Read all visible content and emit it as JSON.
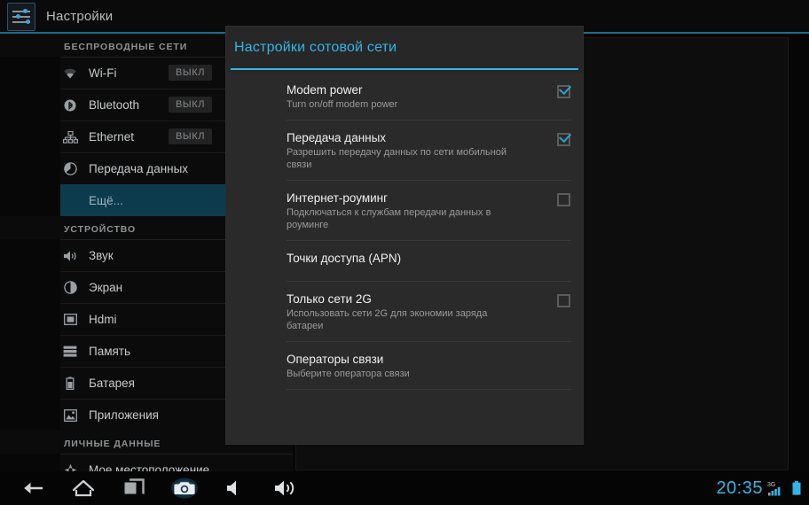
{
  "window": {
    "app_title": "Настройки",
    "app_icon": "sliders-icon"
  },
  "settings_list": {
    "sections": [
      {
        "header": "БЕСПРОВОДНЫЕ СЕТИ",
        "items": [
          {
            "label": "Wi-Fi",
            "icon": "wifi-icon",
            "toggle": "ВЫКЛ",
            "selected": false
          },
          {
            "label": "Bluetooth",
            "icon": "bluetooth-icon",
            "toggle": "ВЫКЛ",
            "selected": false
          },
          {
            "label": "Ethernet",
            "icon": "ethernet-icon",
            "toggle": "ВЫКЛ",
            "selected": false
          },
          {
            "label": "Передача данных",
            "icon": "data-usage-icon",
            "toggle": "",
            "selected": false
          },
          {
            "label": "Ещё...",
            "icon": "",
            "toggle": "",
            "selected": true
          }
        ]
      },
      {
        "header": "УСТРОЙСТВО",
        "items": [
          {
            "label": "Звук",
            "icon": "sound-icon",
            "toggle": "",
            "selected": false
          },
          {
            "label": "Экран",
            "icon": "display-icon",
            "toggle": "",
            "selected": false
          },
          {
            "label": "Hdmi",
            "icon": "hdmi-icon",
            "toggle": "",
            "selected": false
          },
          {
            "label": "Память",
            "icon": "storage-icon",
            "toggle": "",
            "selected": false
          },
          {
            "label": "Батарея",
            "icon": "battery-icon",
            "toggle": "",
            "selected": false
          },
          {
            "label": "Приложения",
            "icon": "apps-icon",
            "toggle": "",
            "selected": false
          }
        ]
      },
      {
        "header": "ЛИЧНЫЕ ДАННЫЕ",
        "items": [
          {
            "label": "Мое местоположение",
            "icon": "location-icon",
            "toggle": "",
            "selected": false
          }
        ]
      }
    ]
  },
  "dialog": {
    "title": "Настройки сотовой сети",
    "preferences": [
      {
        "title": "Modem power",
        "summary": "Turn on/off modem power",
        "has_checkbox": true,
        "checked": true
      },
      {
        "title": "Передача данных",
        "summary": "Разрешить передачу данных по сети мобильной связи",
        "has_checkbox": true,
        "checked": true
      },
      {
        "title": "Интернет-роуминг",
        "summary": "Подключаться к службам передачи данных в роуминге",
        "has_checkbox": true,
        "checked": false
      },
      {
        "title": "Точки доступа (APN)",
        "summary": "",
        "has_checkbox": false,
        "checked": false
      },
      {
        "title": "Только сети 2G",
        "summary": "Использовать сети 2G для экономии заряда батареи",
        "has_checkbox": true,
        "checked": false
      },
      {
        "title": "Операторы связи",
        "summary": "Выберите оператора связи",
        "has_checkbox": false,
        "checked": false
      }
    ]
  },
  "system_bar": {
    "buttons": [
      {
        "name": "back-icon"
      },
      {
        "name": "home-icon"
      },
      {
        "name": "recents-icon"
      },
      {
        "name": "screenshot-camera-icon"
      },
      {
        "name": "volume-down-icon"
      },
      {
        "name": "volume-up-icon"
      }
    ],
    "clock": "20:35",
    "network_label": "3G",
    "signal_icon": "signal-bars-icon",
    "battery_icon": "battery-full-icon"
  },
  "colors": {
    "accent_blue": "#33b5e5",
    "selected_row": "#0c3b4d",
    "dialog_bg": "#2a2a2a",
    "titlebar_bg": "#0a0a0a"
  }
}
